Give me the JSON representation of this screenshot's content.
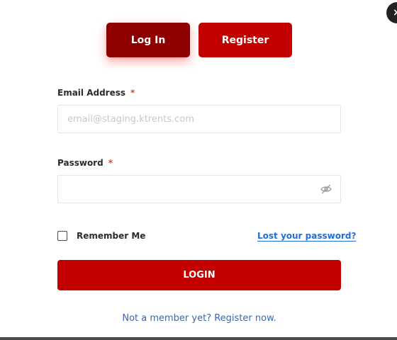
{
  "close": {
    "glyph": "×"
  },
  "tabs": [
    {
      "label": "Log In",
      "active": true
    },
    {
      "label": "Register",
      "active": false
    }
  ],
  "form": {
    "email": {
      "label": "Email Address",
      "required_mark": "*",
      "placeholder": "email@staging.ktrents.com",
      "value": ""
    },
    "password": {
      "label": "Password",
      "required_mark": "*",
      "value": "",
      "visibility_icon": "eye-slash-icon"
    },
    "remember_label": "Remember Me",
    "remember_checked": false,
    "lost_password_link": "Lost your password?",
    "submit_label": "LOGIN",
    "footer_link": "Not a member yet? Register now."
  },
  "colors": {
    "tab_active": "#8e0000",
    "primary": "#c20000",
    "link_blue": "#1e6fd9",
    "footer_link": "#3f67a6",
    "required": "#e0413a"
  }
}
